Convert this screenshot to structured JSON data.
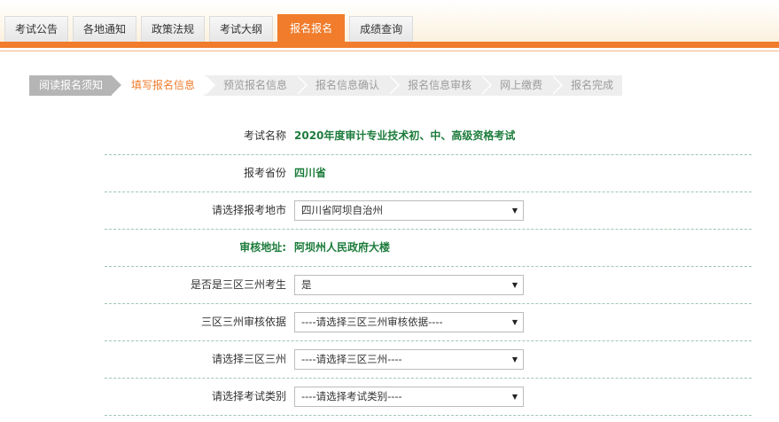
{
  "nav": {
    "tabs": [
      {
        "label": "考试公告"
      },
      {
        "label": "各地通知"
      },
      {
        "label": "政策法规"
      },
      {
        "label": "考试大纲"
      },
      {
        "label": "报名报名"
      },
      {
        "label": "成绩查询"
      }
    ],
    "active_index": 4
  },
  "steps": [
    {
      "label": "阅读报名须知",
      "state": "done"
    },
    {
      "label": "填写报名信息",
      "state": "current"
    },
    {
      "label": "预览报名信息",
      "state": "todo"
    },
    {
      "label": "报名信息确认",
      "state": "todo"
    },
    {
      "label": "报名信息审核",
      "state": "todo"
    },
    {
      "label": "网上缴费",
      "state": "todo"
    },
    {
      "label": "报名完成",
      "state": "todo"
    }
  ],
  "form": {
    "exam_name_label": "考试名称",
    "exam_name_value": "2020年度审计专业技术初、中、高级资格考试",
    "province_label": "报考省份",
    "province_value": "四川省",
    "city_label": "请选择报考地市",
    "city_value": "四川省阿坝自治州",
    "audit_addr_label": "审核地址:",
    "audit_addr_value": "阿坝州人民政府大楼",
    "three_state_label": "是否是三区三州考生",
    "three_state_value": "是",
    "basis_label": "三区三州审核依据",
    "basis_value": "----请选择三区三州审核依据----",
    "region_label": "请选择三区三州",
    "region_value": "----请选择三区三州----",
    "category_label": "请选择考试类别",
    "category_value": "----请选择考试类别----"
  },
  "colors": {
    "accent": "#f07c2c",
    "green_text": "#1d7c3c",
    "step_done": "#b5b5b5",
    "step_todo": "#eeeeee"
  },
  "icons": {
    "dropdown": "chevron-down-icon"
  }
}
